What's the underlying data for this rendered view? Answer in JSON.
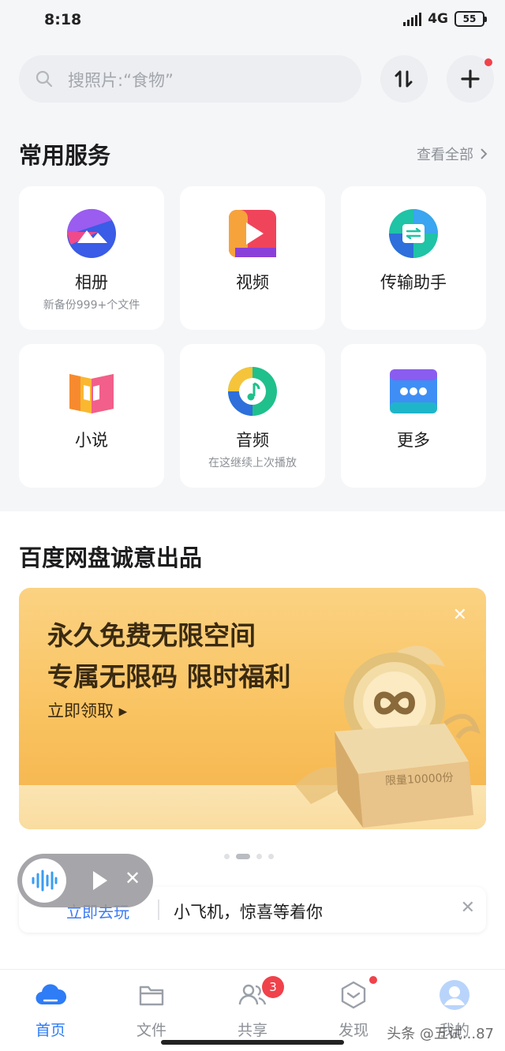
{
  "status": {
    "time": "8:18",
    "network": "4G",
    "battery": "55"
  },
  "search": {
    "placeholder": "搜照片:“食物”"
  },
  "services": {
    "title": "常用服务",
    "see_all": "查看全部",
    "items": [
      {
        "label": "相册",
        "sub": "新备份999+个文件",
        "icon": "album-icon"
      },
      {
        "label": "视频",
        "sub": "",
        "icon": "video-icon"
      },
      {
        "label": "传输助手",
        "sub": "",
        "icon": "transfer-icon"
      },
      {
        "label": "小说",
        "sub": "",
        "icon": "novel-icon"
      },
      {
        "label": "音频",
        "sub": "在这继续上次播放",
        "icon": "audio-icon"
      },
      {
        "label": "更多",
        "sub": "",
        "icon": "more-icon"
      }
    ]
  },
  "featured": {
    "title": "百度网盘诚意出品",
    "banner": {
      "line1": "永久免费无限空间",
      "line2": "专属无限码 限时福利",
      "cta": "立即领取 ▸",
      "box_label": "限量10000份"
    },
    "carousel": {
      "count": 4,
      "active": 1
    }
  },
  "notice": {
    "cta": "立即去玩",
    "text": "小飞机，惊喜等着你"
  },
  "tabs": [
    {
      "label": "首页",
      "icon": "cloud-icon",
      "active": true
    },
    {
      "label": "文件",
      "icon": "folder-icon",
      "active": false
    },
    {
      "label": "共享",
      "icon": "people-icon",
      "active": false,
      "badge": "3"
    },
    {
      "label": "发现",
      "icon": "discover-icon",
      "active": false
    },
    {
      "label": "我的",
      "icon": "avatar-icon",
      "active": false
    }
  ],
  "watermark": "头条 @五试...87",
  "colors": {
    "accent": "#2e7cf6",
    "badge": "#f0424b",
    "banner": "#f9c25f"
  }
}
